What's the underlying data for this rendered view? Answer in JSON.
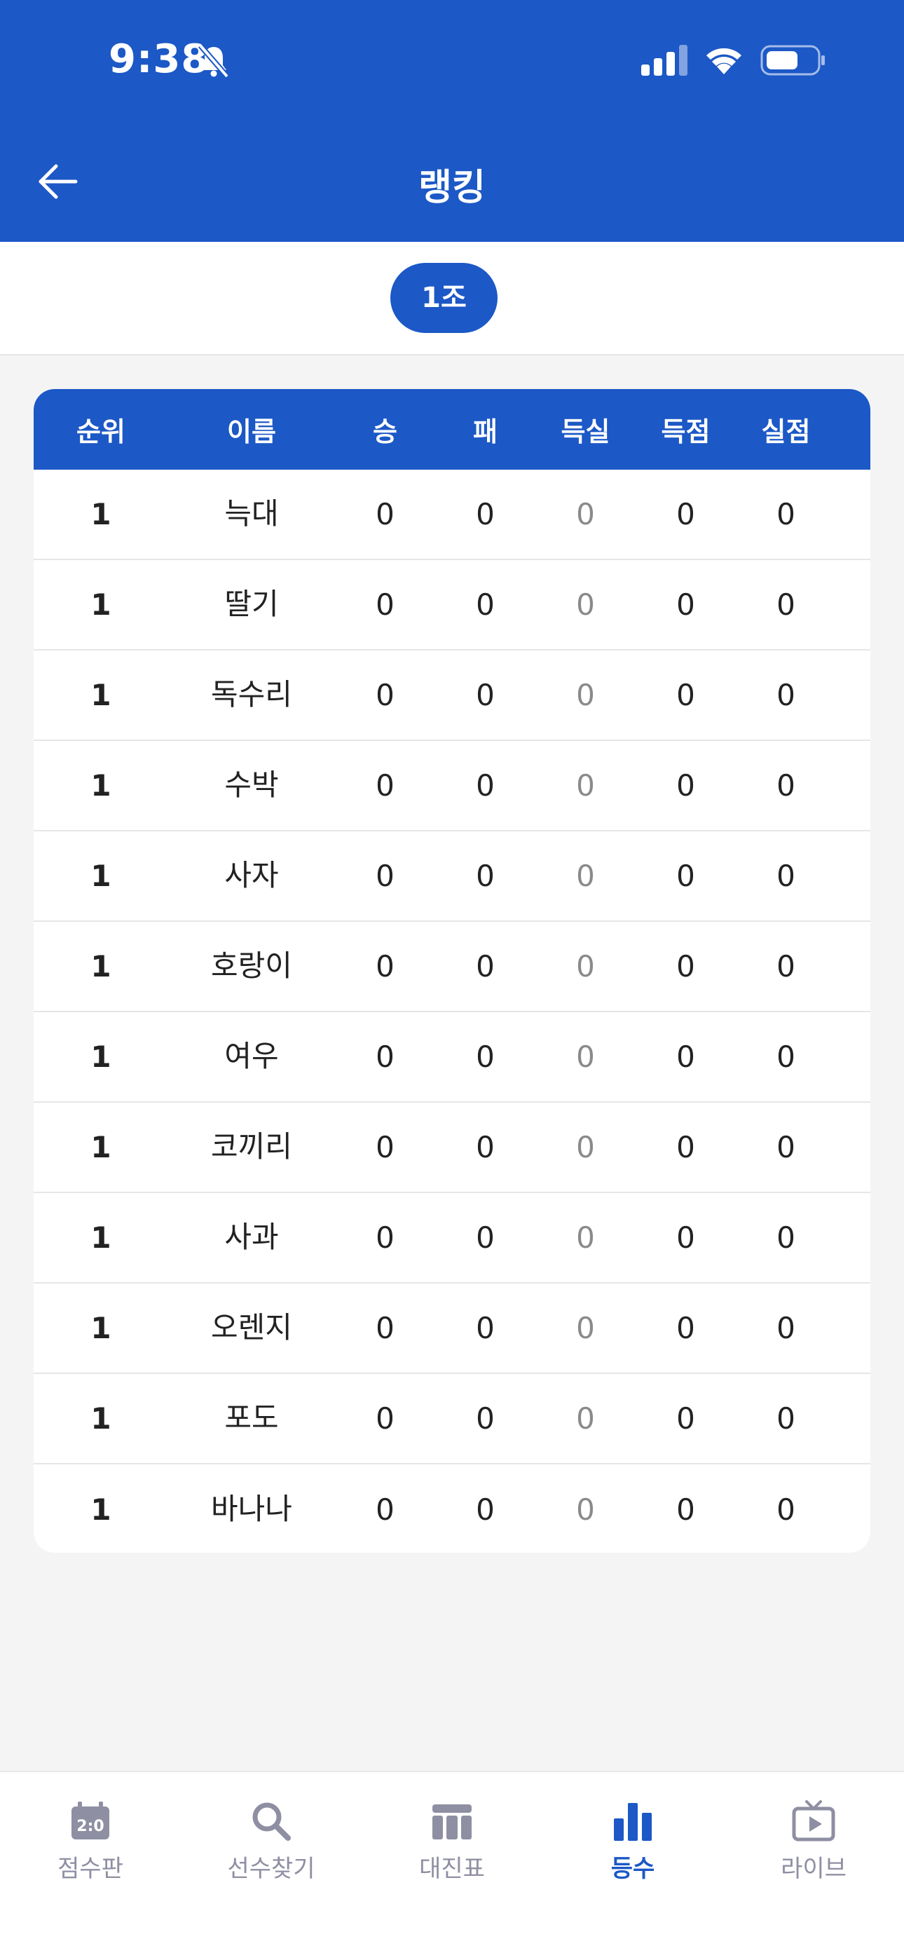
{
  "status_bar": {
    "time": "9:38"
  },
  "header": {
    "title": "랭킹"
  },
  "group_selector": {
    "selected": "1조"
  },
  "table": {
    "columns": [
      "순위",
      "이름",
      "승",
      "패",
      "득실",
      "득점",
      "실점"
    ],
    "rows": [
      {
        "rank": "1",
        "name": "늑대",
        "win": "0",
        "loss": "0",
        "diff": "0",
        "scored": "0",
        "conceded": "0"
      },
      {
        "rank": "1",
        "name": "딸기",
        "win": "0",
        "loss": "0",
        "diff": "0",
        "scored": "0",
        "conceded": "0"
      },
      {
        "rank": "1",
        "name": "독수리",
        "win": "0",
        "loss": "0",
        "diff": "0",
        "scored": "0",
        "conceded": "0"
      },
      {
        "rank": "1",
        "name": "수박",
        "win": "0",
        "loss": "0",
        "diff": "0",
        "scored": "0",
        "conceded": "0"
      },
      {
        "rank": "1",
        "name": "사자",
        "win": "0",
        "loss": "0",
        "diff": "0",
        "scored": "0",
        "conceded": "0"
      },
      {
        "rank": "1",
        "name": "호랑이",
        "win": "0",
        "loss": "0",
        "diff": "0",
        "scored": "0",
        "conceded": "0"
      },
      {
        "rank": "1",
        "name": "여우",
        "win": "0",
        "loss": "0",
        "diff": "0",
        "scored": "0",
        "conceded": "0"
      },
      {
        "rank": "1",
        "name": "코끼리",
        "win": "0",
        "loss": "0",
        "diff": "0",
        "scored": "0",
        "conceded": "0"
      },
      {
        "rank": "1",
        "name": "사과",
        "win": "0",
        "loss": "0",
        "diff": "0",
        "scored": "0",
        "conceded": "0"
      },
      {
        "rank": "1",
        "name": "오렌지",
        "win": "0",
        "loss": "0",
        "diff": "0",
        "scored": "0",
        "conceded": "0"
      },
      {
        "rank": "1",
        "name": "포도",
        "win": "0",
        "loss": "0",
        "diff": "0",
        "scored": "0",
        "conceded": "0"
      },
      {
        "rank": "1",
        "name": "바나나",
        "win": "0",
        "loss": "0",
        "diff": "0",
        "scored": "0",
        "conceded": "0"
      }
    ]
  },
  "bottom_nav": {
    "items": [
      {
        "label": "점수판",
        "icon": "scoreboard-icon",
        "active": false
      },
      {
        "label": "선수찾기",
        "icon": "search-icon",
        "active": false
      },
      {
        "label": "대진표",
        "icon": "bracket-table-icon",
        "active": false
      },
      {
        "label": "등수",
        "icon": "bar-chart-icon",
        "active": true
      },
      {
        "label": "라이브",
        "icon": "live-tv-icon",
        "active": false
      }
    ]
  },
  "colors": {
    "primary": "#1c58c6",
    "background": "#f4f4f4",
    "nav_inactive": "#8f8fa3",
    "muted_value": "#8a8a8a"
  }
}
